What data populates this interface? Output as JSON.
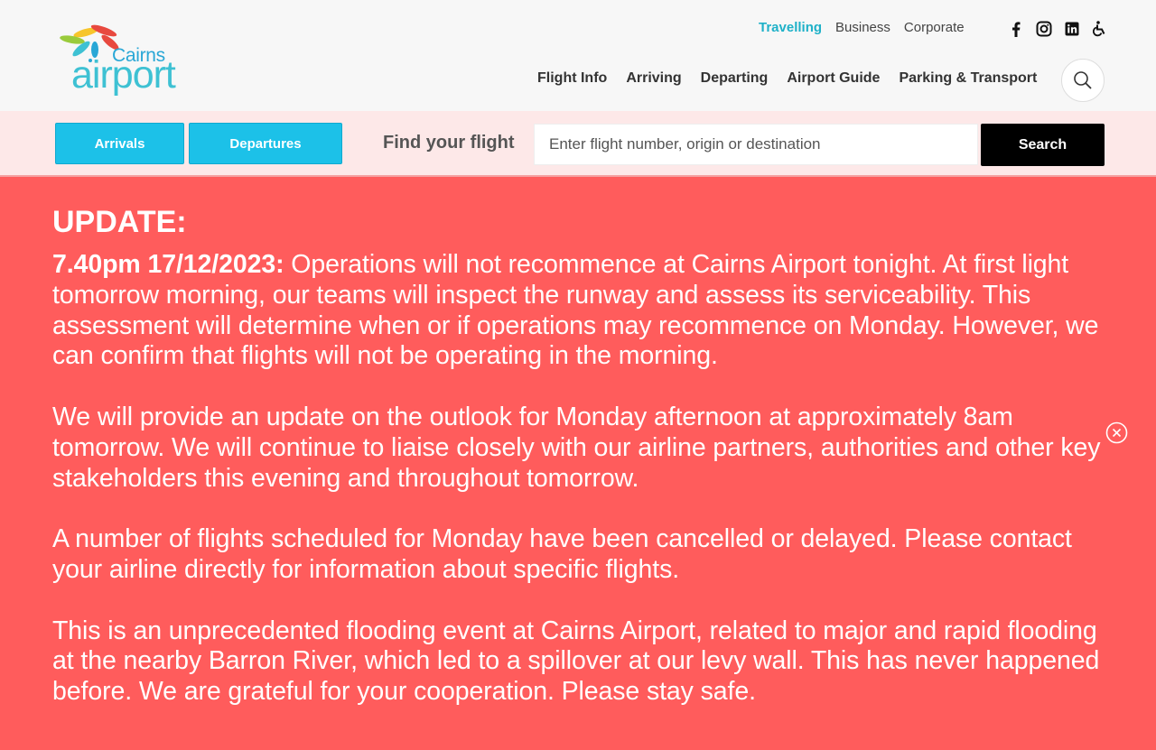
{
  "header": {
    "logo": {
      "line1": "Cairns",
      "line2": "airport"
    },
    "top_nav": [
      "Travelling",
      "Business",
      "Corporate"
    ],
    "social_icons": [
      "facebook-icon",
      "instagram-icon",
      "linkedin-icon",
      "accessibility-icon"
    ],
    "main_nav": [
      "Flight Info",
      "Arriving",
      "Departing",
      "Airport Guide",
      "Parking & Transport"
    ],
    "accent_color": "#1fb1c8"
  },
  "flight_bar": {
    "arrivals_label": "Arrivals",
    "departures_label": "Departures",
    "find_label": "Find your flight",
    "search_placeholder": "Enter flight number, origin or destination",
    "search_label": "Search"
  },
  "alert": {
    "heading": "UPDATE:",
    "timestamp": "7.40pm 17/12/2023:",
    "paragraphs": [
      " Operations will not recommence at Cairns Airport tonight. At first light tomorrow morning, our teams will inspect the runway and assess its serviceability. This assessment will determine when or if operations may recommence on Monday. However, we can confirm that flights will not be operating in the morning.",
      "We will provide an update on the outlook for Monday afternoon at approximately 8am tomorrow. We will continue to liaise closely with our airline partners, authorities and other key stakeholders this evening and throughout tomorrow.",
      "A number of flights scheduled for Monday have been cancelled or delayed. Please contact your airline directly for information about specific flights.",
      "This is an unprecedented flooding event at Cairns Airport, related to major and rapid flooding at the nearby Barron River, which led to a spillover at our levy wall. This has never happened before. We are grateful for your cooperation. Please stay safe."
    ],
    "background_color": "#ff5c5c"
  }
}
